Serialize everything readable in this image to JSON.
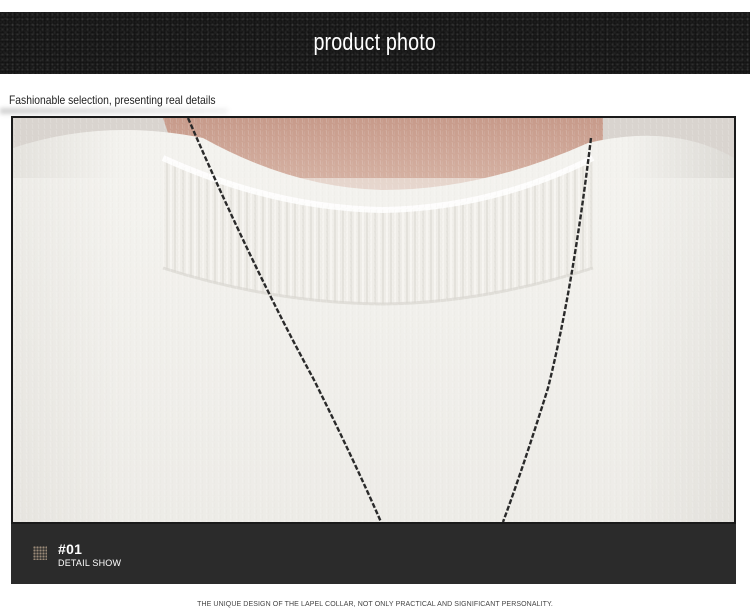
{
  "banner": {
    "title": "product photo"
  },
  "subtitle": "Fashionable selection, presenting real details",
  "caption": {
    "number": "#01",
    "label": "DETAIL SHOW"
  },
  "footer": {
    "text": "THE UNIQUE DESIGN OF THE LAPEL COLLAR, NOT ONLY PRACTICAL AND SIGNIFICANT PERSONALITY."
  },
  "colors": {
    "banner_bg": "#1d1d1d",
    "caption_bg": "#2b2b2b",
    "sweater": "#f1efea",
    "skin": "#d7b3a3"
  },
  "icons": {
    "caption_icon": "dotted-square-icon"
  }
}
